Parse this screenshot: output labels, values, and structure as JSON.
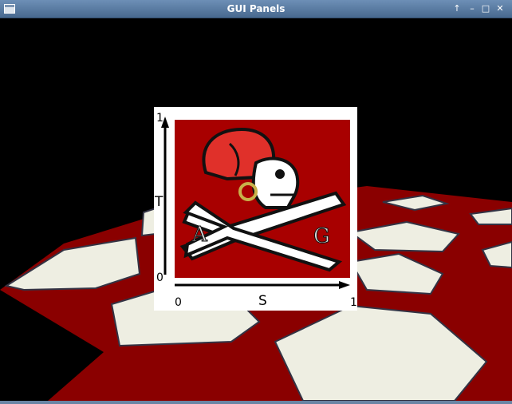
{
  "window": {
    "title": "GUI Panels",
    "controls": [
      "↑",
      "–",
      "□",
      "✕"
    ]
  },
  "panel": {
    "t_top_label": "1",
    "t_axis_label": "T",
    "t_bottom_label": "0",
    "s_left_label": "0",
    "s_axis_label": "S",
    "s_right_label": "1",
    "texture_letter_left": "A",
    "texture_letter_right": "G"
  },
  "colors": {
    "texture_red": "#a80000",
    "floor_red": "#8a0000",
    "floor_white": "#f0f0e8",
    "title_bar": "#5a7ba2"
  }
}
